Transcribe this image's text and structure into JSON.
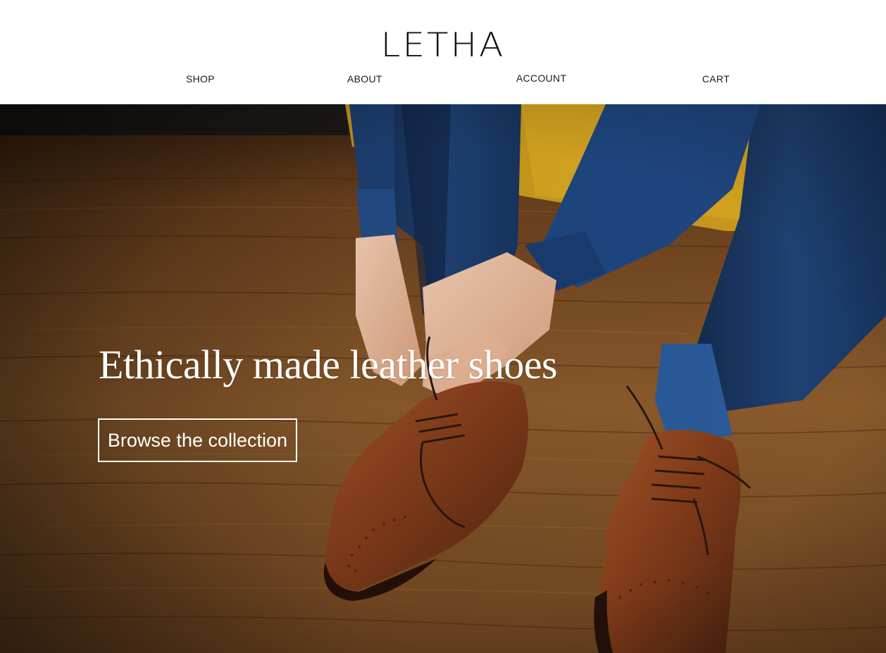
{
  "brand": {
    "name": "LETHA"
  },
  "nav": {
    "items": [
      {
        "label": "SHOP"
      },
      {
        "label": "ABOUT"
      },
      {
        "label": "ACCOUNT"
      },
      {
        "label": "CART"
      }
    ]
  },
  "hero": {
    "headline": "Ethically made leather shoes",
    "cta_label": "Browse the collection",
    "image_subject": "person in navy suit tying laces of brown leather brogue shoes on a wooden floor"
  },
  "colors": {
    "text_dark": "#111111",
    "floor_wood": "#7a4a22",
    "suit_navy": "#1b3a66",
    "shoe_brown": "#8a3f1c",
    "chair_yellow": "#c89a1a",
    "overlay_text": "#ffffff"
  }
}
